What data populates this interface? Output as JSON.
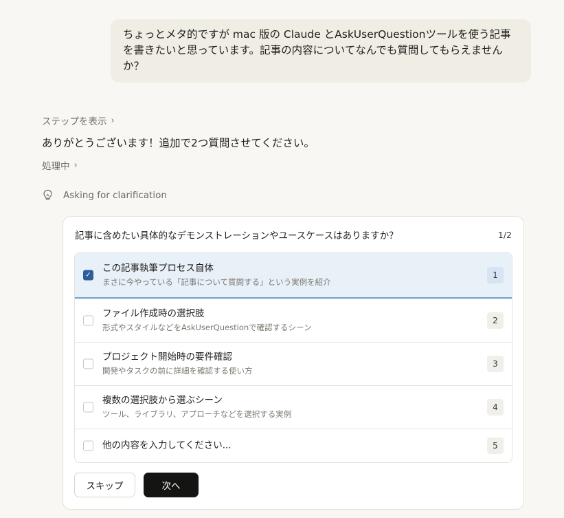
{
  "user_message": "ちょっとメタ的ですが mac 版の Claude とAskUserQuestionツールを使う記事を書きたいと思っています。記事の内容についてなんでも質問してもらえませんか？",
  "steps_link": "ステップを表示",
  "assistant_message": "ありがとうございます！追加で2つ質問させてください。",
  "processing_link": "処理中",
  "asking_label": "Asking for clarification",
  "question": {
    "text": "記事に含めたい具体的なデモンストレーションやユースケースはありますか？",
    "counter": "1/2",
    "options": [
      {
        "title": "この記事執筆プロセス自体",
        "desc": "まさに今やっている「記事について質問する」という実例を紹介",
        "key": "1",
        "checked": true
      },
      {
        "title": "ファイル作成時の選択肢",
        "desc": "形式やスタイルなどをAskUserQuestionで確認するシーン",
        "key": "2",
        "checked": false
      },
      {
        "title": "プロジェクト開始時の要件確認",
        "desc": "開発やタスクの前に詳細を確認する使い方",
        "key": "3",
        "checked": false
      },
      {
        "title": "複数の選択肢から選ぶシーン",
        "desc": "ツール、ライブラリ、アプローチなどを選択する実例",
        "key": "4",
        "checked": false
      },
      {
        "title": "他の内容を入力してください...",
        "desc": "",
        "key": "5",
        "checked": false
      }
    ],
    "skip_label": "スキップ",
    "next_label": "次へ"
  },
  "icons": {
    "chevron": "chevron-right-icon",
    "asking": "lightbulb-icon",
    "check": "checkmark-icon"
  },
  "colors": {
    "background": "#f8f7f3",
    "user_bubble": "#efede4",
    "selected_option": "#e8f0f8",
    "checkbox_checked": "#2b5c9c",
    "next_button": "#141413"
  }
}
